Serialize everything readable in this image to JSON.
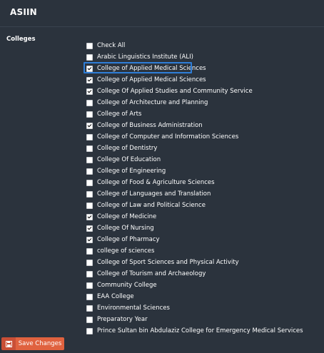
{
  "header": {
    "title": "ASIIN"
  },
  "section": {
    "label": "Colleges"
  },
  "items": [
    {
      "label": "Check All",
      "checked": false
    },
    {
      "label": "Arabic Linguistics Institute (ALI)",
      "checked": false
    },
    {
      "label": "College of Applied Medical Sciences",
      "checked": true,
      "focused": true
    },
    {
      "label": "College of Applied Medical Sciences",
      "checked": true
    },
    {
      "label": "College Of Applied Studies and Community Service",
      "checked": true
    },
    {
      "label": "College of Architecture and Planning",
      "checked": false
    },
    {
      "label": "College of Arts",
      "checked": false
    },
    {
      "label": "College of Business Administration",
      "checked": true
    },
    {
      "label": "College of Computer and Information Sciences",
      "checked": false
    },
    {
      "label": "College of Dentistry",
      "checked": false
    },
    {
      "label": "College Of Education",
      "checked": false
    },
    {
      "label": "College of Engineering",
      "checked": false
    },
    {
      "label": "College of Food & Agriculture Sciences",
      "checked": false
    },
    {
      "label": "College of Languages and Translation",
      "checked": false
    },
    {
      "label": "College of Law and Political Science",
      "checked": false
    },
    {
      "label": "College of Medicine",
      "checked": true
    },
    {
      "label": "College Of Nursing",
      "checked": true
    },
    {
      "label": "College of Pharmacy",
      "checked": true
    },
    {
      "label": "college of sciences",
      "checked": false
    },
    {
      "label": "College of Sport Sciences and Physical Activity",
      "checked": false
    },
    {
      "label": "College of Tourism and Archaeology",
      "checked": false
    },
    {
      "label": "Community College",
      "checked": false
    },
    {
      "label": "EAA College",
      "checked": false
    },
    {
      "label": "Environmental Sciences",
      "checked": false
    },
    {
      "label": "Preparatory Year",
      "checked": false
    },
    {
      "label": "Prince Sultan bin Abdulaziz College for Emergency Medical Services",
      "checked": false
    }
  ],
  "footer": {
    "save_label": "Save Changes",
    "save_icon": "floppy-disk-icon"
  },
  "colors": {
    "background": "#2b333d",
    "accent": "#e0623f",
    "focus": "#2f7ed8"
  }
}
